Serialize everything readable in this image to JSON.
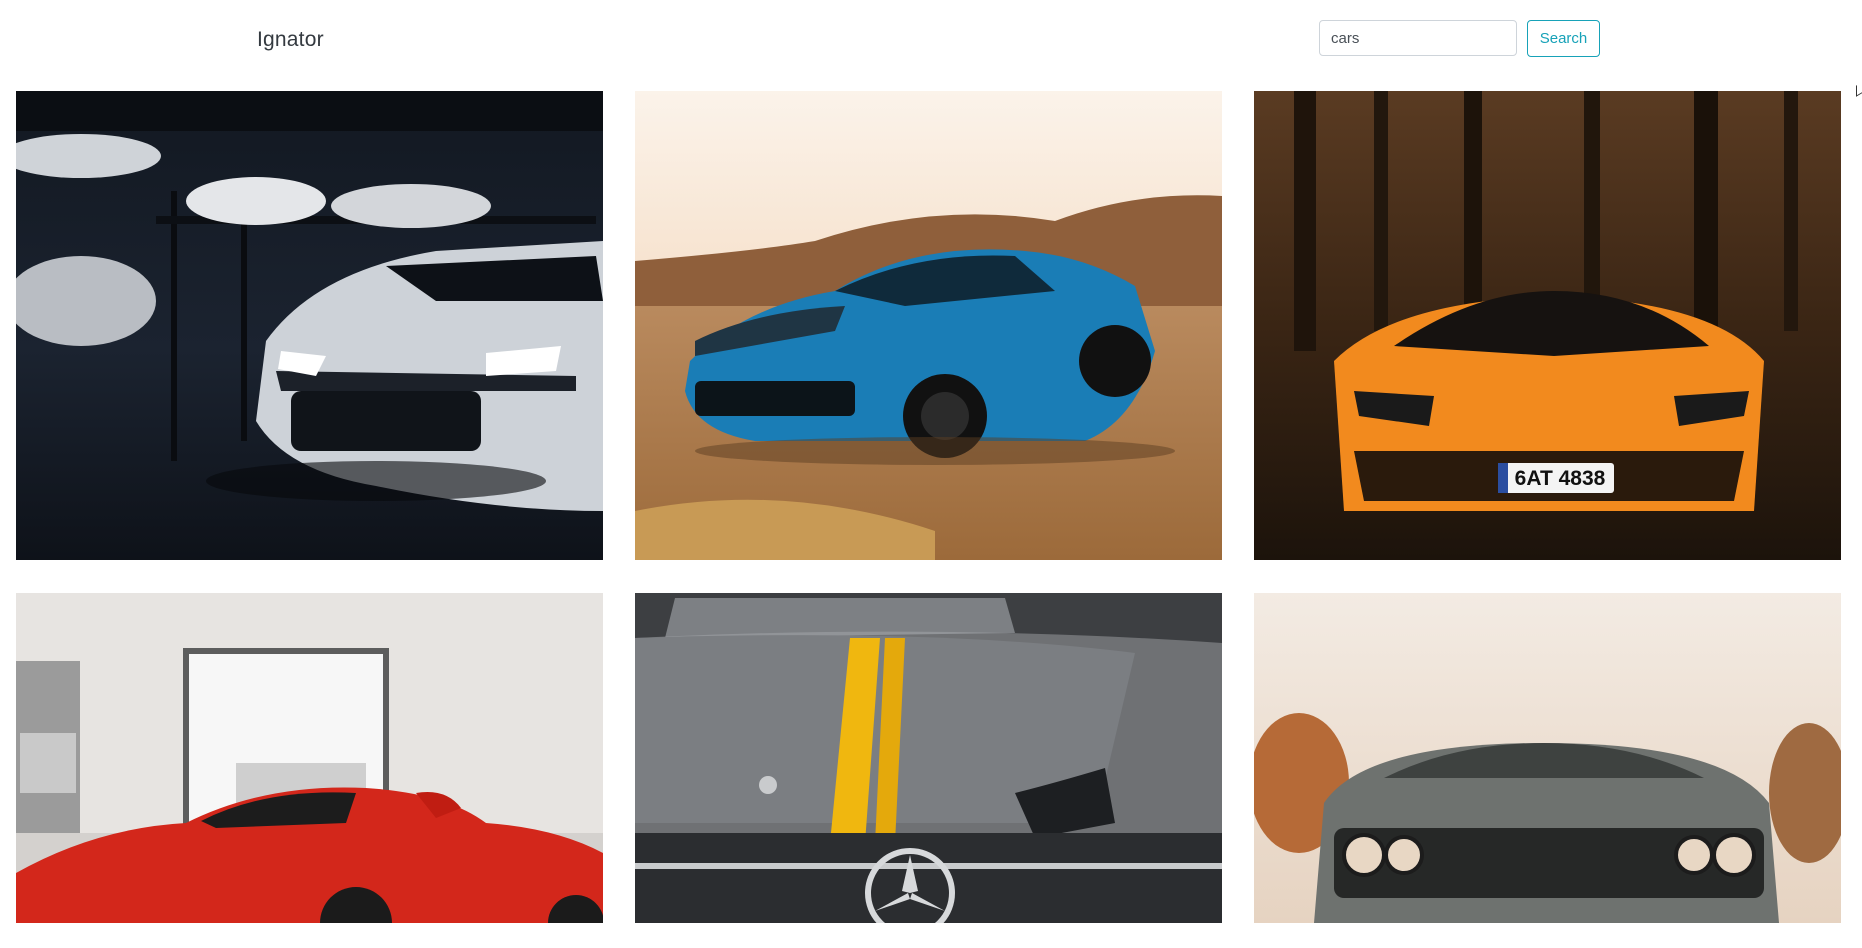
{
  "navbar": {
    "brand": "Ignator",
    "search": {
      "value": "cars"
    },
    "search_button": "Search"
  },
  "gallery": {
    "images": [
      {
        "name": "white-camaro-garage-image"
      },
      {
        "name": "blue-camaro-desert-image"
      },
      {
        "name": "orange-lamborghini-forest-image",
        "plate": "6AT 4838"
      },
      {
        "name": "red-ferrari-showroom-image"
      },
      {
        "name": "grey-mercedes-hood-image"
      },
      {
        "name": "grey-challenger-front-image"
      }
    ]
  }
}
